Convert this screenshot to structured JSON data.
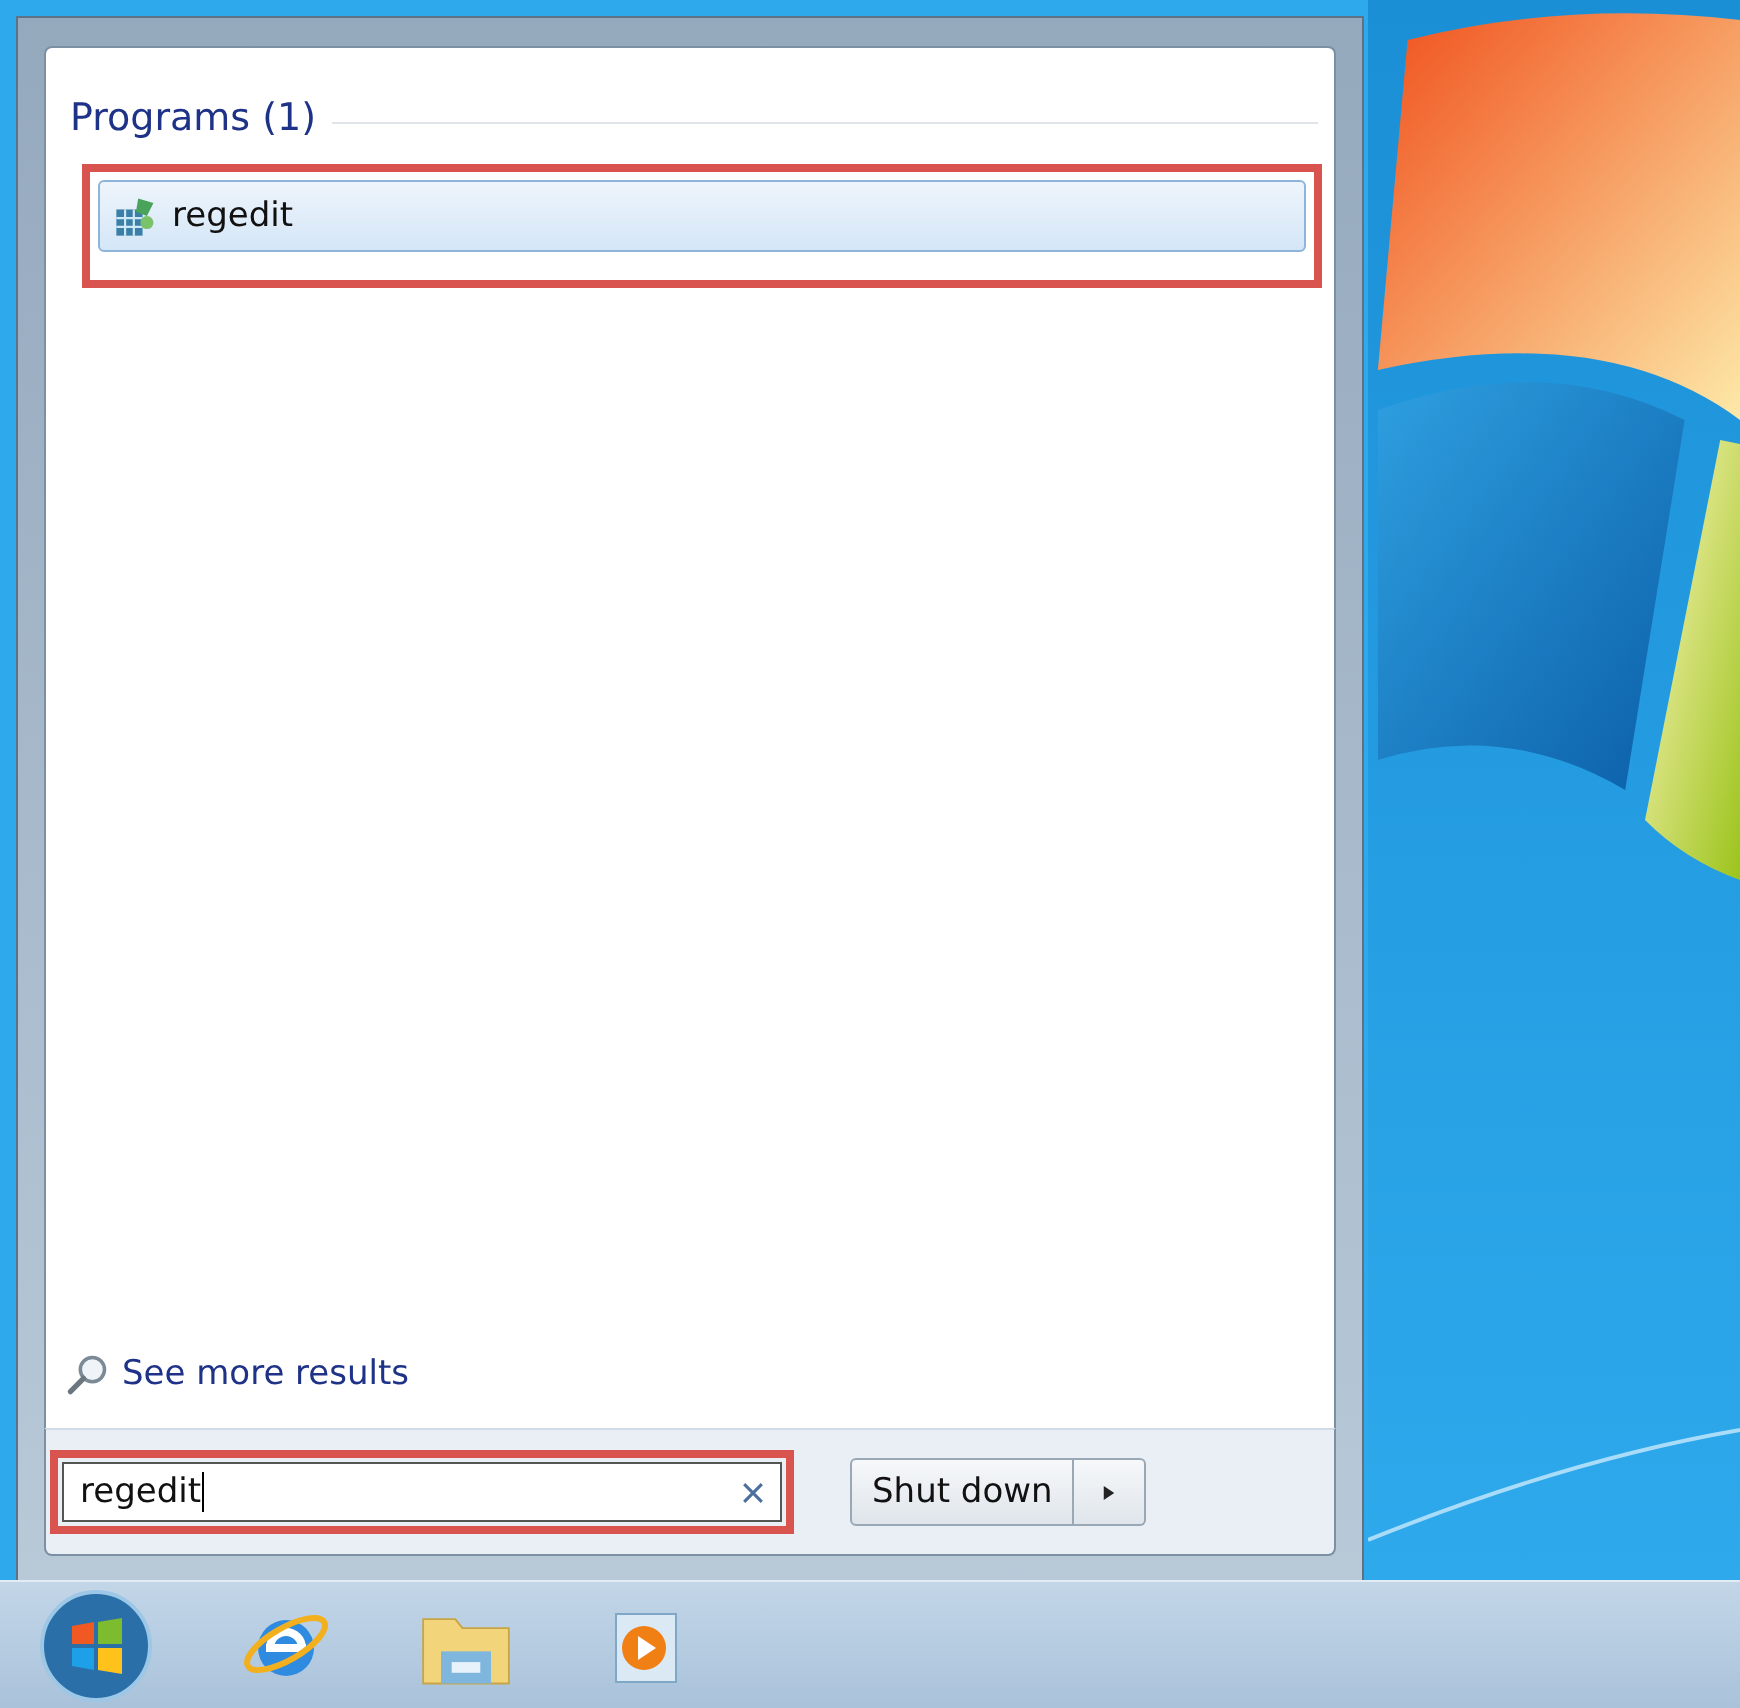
{
  "start_menu": {
    "programs": {
      "title": "Programs (1)",
      "items": [
        {
          "label": "regedit",
          "selected": true
        }
      ]
    },
    "see_more": "See more results",
    "search": {
      "value": "regedit"
    },
    "shutdown": {
      "label": "Shut down"
    }
  }
}
